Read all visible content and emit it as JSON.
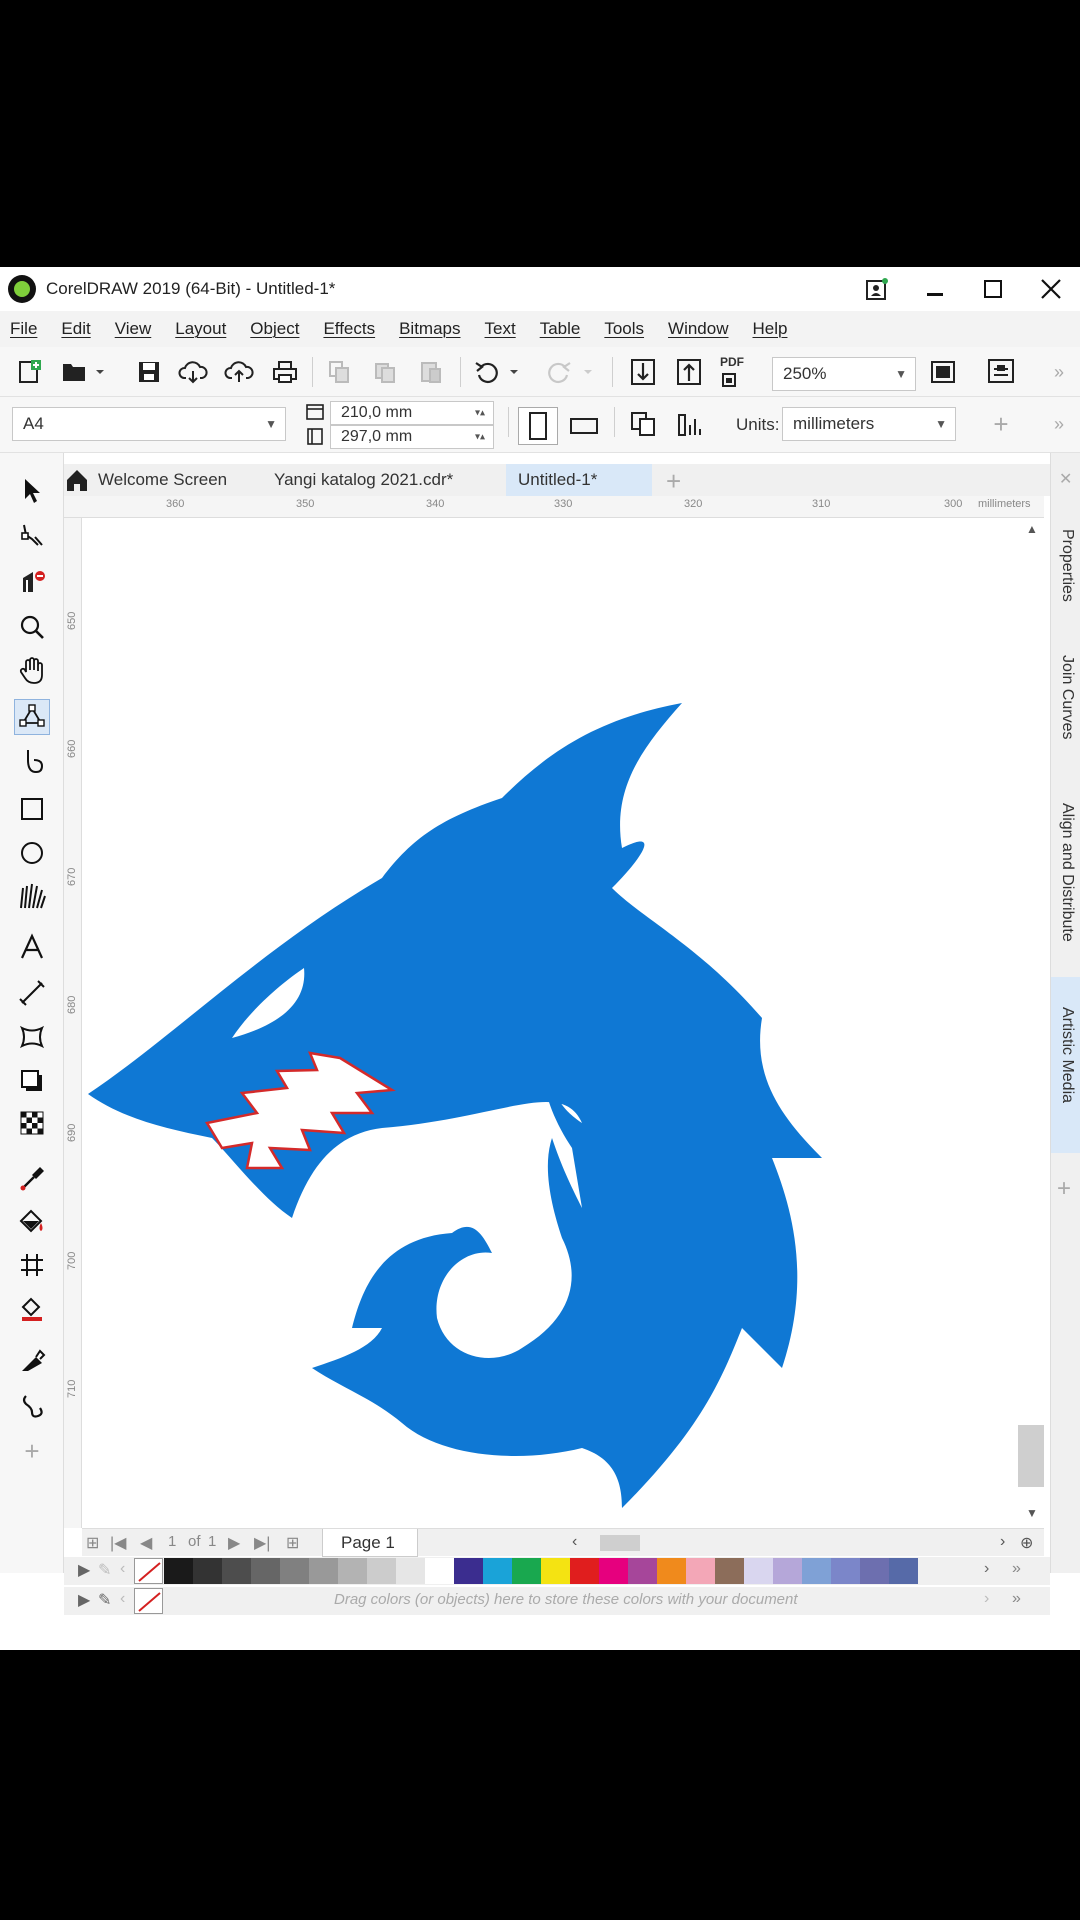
{
  "window": {
    "title": "CorelDRAW 2019 (64-Bit) - Untitled-1*"
  },
  "menu": [
    "File",
    "Edit",
    "View",
    "Layout",
    "Object",
    "Effects",
    "Bitmaps",
    "Text",
    "Table",
    "Tools",
    "Window",
    "Help"
  ],
  "toolbar": {
    "zoom_value": "250%",
    "pdf_label": "PDF"
  },
  "property_bar": {
    "page_size": "A4",
    "width": "210,0 mm",
    "height": "297,0 mm",
    "units_label": "Units:",
    "units_value": "millimeters"
  },
  "tabs": [
    {
      "label": "Welcome Screen",
      "active": false
    },
    {
      "label": "Yangi katalog 2021.cdr*",
      "active": false
    },
    {
      "label": "Untitled-1*",
      "active": true
    }
  ],
  "ruler": {
    "h_labels": [
      "360",
      "350",
      "340",
      "330",
      "320",
      "310",
      "300"
    ],
    "h_unit": "millimeters",
    "v_labels": [
      "650",
      "660",
      "670",
      "680",
      "690",
      "700",
      "710"
    ]
  },
  "dockers": [
    "Properties",
    "Join Curves",
    "Align and Distribute",
    "Artistic Media"
  ],
  "page_nav": {
    "current": "1",
    "of_label": "of",
    "total": "1",
    "page_tab": "Page 1"
  },
  "palette": {
    "colors": [
      "#1a1a1a",
      "#333333",
      "#4d4d4d",
      "#666666",
      "#808080",
      "#999999",
      "#b3b3b3",
      "#cccccc",
      "#e6e6e6",
      "#ffffff",
      "#3b2d8f",
      "#1aa3d8",
      "#19a84f",
      "#f4e312",
      "#e01e1e",
      "#e6007e",
      "#a6469a",
      "#f08a1c",
      "#f3a7b7",
      "#8c6d5a",
      "#d9d6ef",
      "#b5a7d9",
      "#7fa1d6",
      "#7b86c9",
      "#6d6faf",
      "#566aa8"
    ],
    "document_hint": "Drag colors (or objects) here to store these colors with your document"
  },
  "artwork": {
    "fill_color": "#0f78d4",
    "teeth_outline": "#d42a2a"
  }
}
